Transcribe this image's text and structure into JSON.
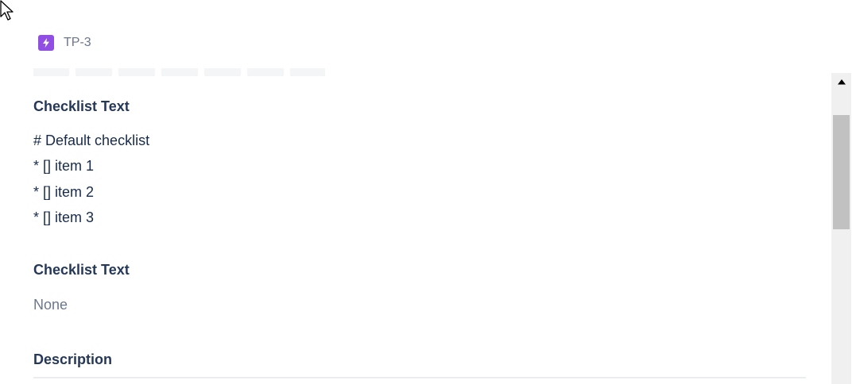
{
  "issue": {
    "key": "TP-3",
    "type_icon": "lightning-icon",
    "type_color": "#904ee2"
  },
  "fields": {
    "checklist_1": {
      "heading": "Checklist Text",
      "lines": [
        "# Default checklist",
        "* [] item 1",
        "* [] item 2",
        "* [] item 3"
      ]
    },
    "checklist_2": {
      "heading": "Checklist Text",
      "value": "None"
    },
    "description": {
      "heading": "Description"
    }
  },
  "scrollbar": {
    "up_icon": "triangle-up-icon"
  },
  "cursor": {
    "icon": "mouse-pointer-icon"
  },
  "colors": {
    "text_primary": "#172b4d",
    "text_heading": "#253858",
    "text_subtle": "#6b778c"
  }
}
